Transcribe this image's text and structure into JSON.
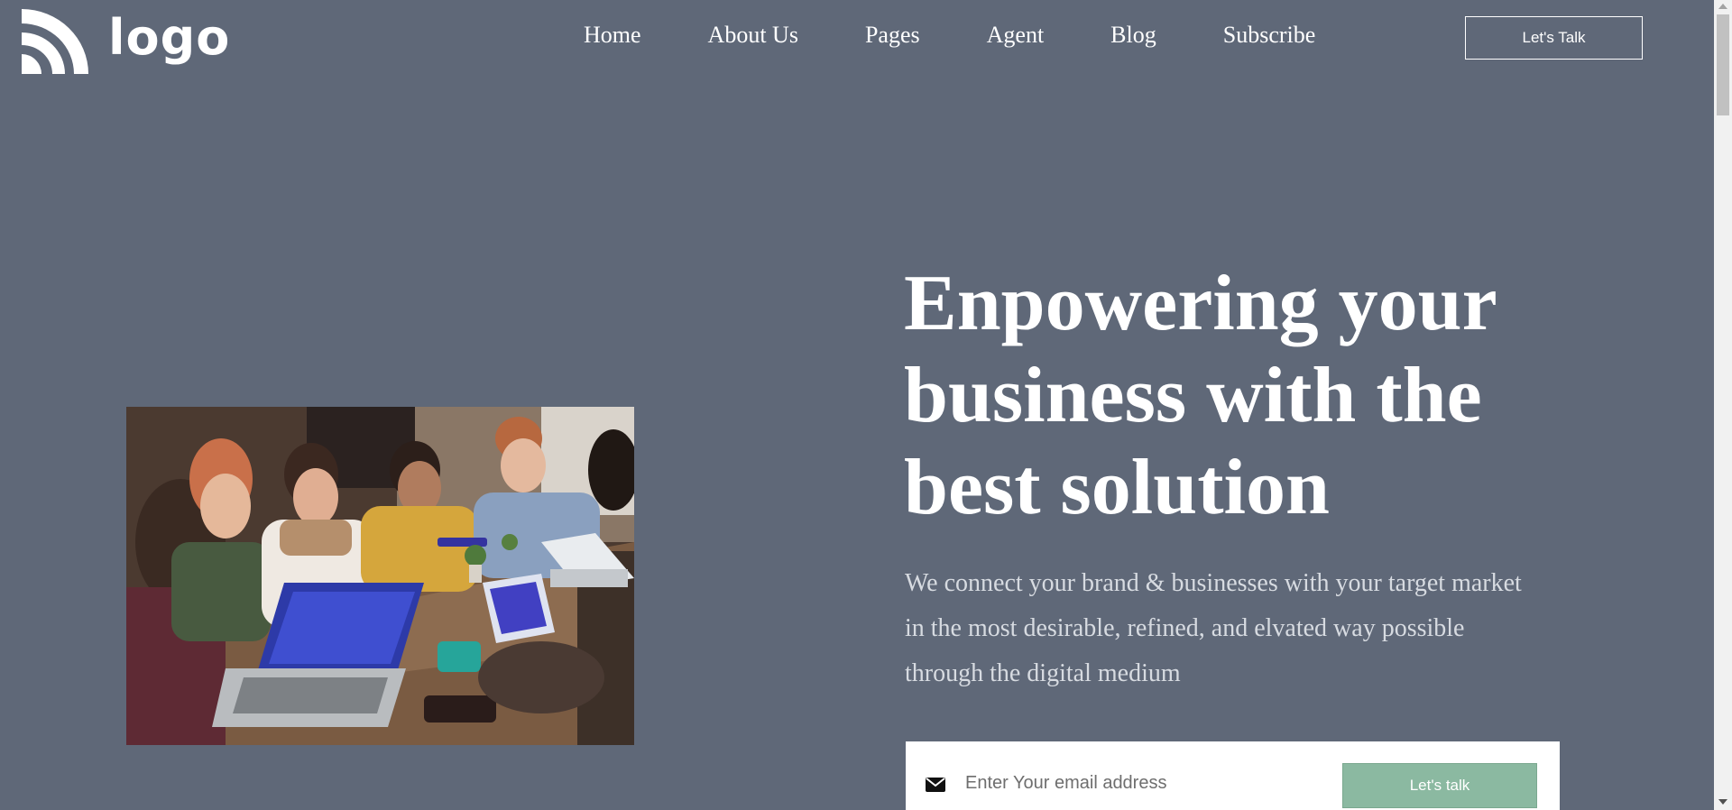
{
  "header": {
    "logo_text": "logo",
    "logo_icon": "wifi-arcs-icon",
    "nav": [
      {
        "label": "Home"
      },
      {
        "label": "About Us"
      },
      {
        "label": "Pages"
      },
      {
        "label": "Agent"
      },
      {
        "label": "Blog"
      },
      {
        "label": "Subscribe"
      }
    ],
    "cta_label": "Let's Talk"
  },
  "hero": {
    "headline": "Enpowering your business with the best solution",
    "subtext": "We connect your brand & businesses with your target market in the most desirable, refined, and elvated way possible through the digital medium",
    "image_alt": "team-meeting-photo"
  },
  "subscribe": {
    "email_placeholder": "Enter Your email address",
    "email_value": "",
    "button_label": "Let's talk",
    "icon": "envelope-icon"
  },
  "colors": {
    "background": "#5f6878",
    "accent": "#8bb9a1",
    "text": "#ffffff",
    "subtext": "#d7dbe1"
  }
}
